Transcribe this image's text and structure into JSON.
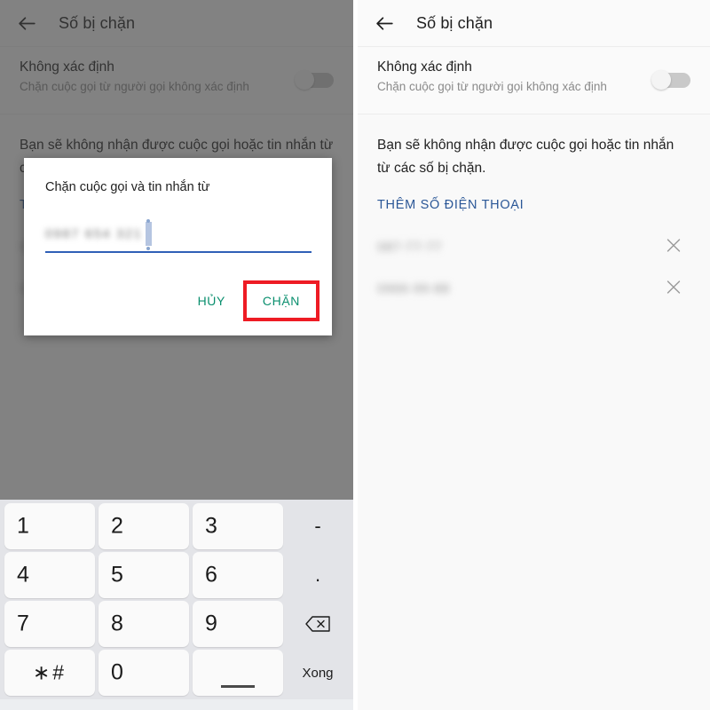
{
  "app": {
    "title": "Số bị chặn",
    "back_icon": "back-arrow-icon",
    "toggle": {
      "title": "Không xác định",
      "subtitle": "Chặn cuộc gọi từ người gọi không xác định",
      "state": "off"
    },
    "body_note": "Bạn sẽ không nhận được cuộc gọi hoặc tin nhắn từ các số bị chặn.",
    "add_number_label": "THÊM SỐ ĐIỆN THOẠI",
    "add_number_color": "#2b5797",
    "blocked_numbers": [
      {
        "number": "087-77-77",
        "remove_icon": "close-icon"
      },
      {
        "number": "0966-99-88",
        "remove_icon": "close-icon"
      }
    ]
  },
  "dialog": {
    "title": "Chặn cuộc gọi và tin nhắn từ",
    "input_value": "0987 654 321",
    "input_placeholder": "",
    "cancel_label": "HỦY",
    "confirm_label": "CHẶN",
    "action_color": "#0a8f6e",
    "highlight_color": "#ee1b24"
  },
  "keyboard": {
    "rows": [
      {
        "keys": [
          "1",
          "2",
          "3"
        ],
        "side": "-"
      },
      {
        "keys": [
          "4",
          "5",
          "6"
        ],
        "side": "."
      },
      {
        "keys": [
          "7",
          "8",
          "9"
        ],
        "side": "backspace-icon"
      },
      {
        "keys": [
          "∗#",
          "0",
          "space"
        ],
        "side": "Xong"
      }
    ],
    "done_label": "Xong",
    "dash_label": "-",
    "dot_label": ".",
    "star_hash_label": "∗#",
    "backspace_icon": "backspace-icon",
    "space_key": "space-key"
  }
}
